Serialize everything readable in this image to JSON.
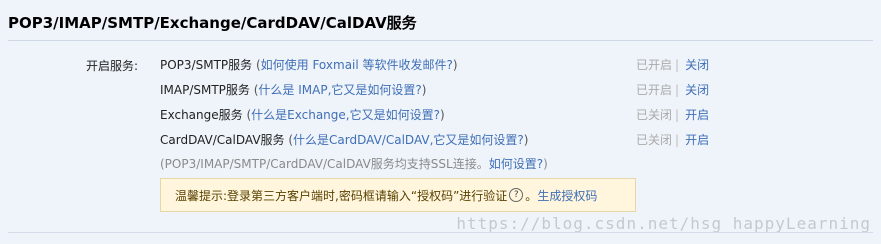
{
  "header": {
    "title": "POP3/IMAP/SMTP/Exchange/CardDAV/CalDAV服务"
  },
  "services_label": "开启服务:",
  "services": [
    {
      "name": "POP3/SMTP服务",
      "paren_open": " (",
      "help": "如何使用 Foxmail 等软件收发邮件?",
      "paren_close": ")",
      "status": "已开启",
      "action": "关闭"
    },
    {
      "name": "IMAP/SMTP服务",
      "paren_open": " (",
      "help": "什么是 IMAP,它又是如何设置?",
      "paren_close": ")",
      "status": "已开启",
      "action": "关闭"
    },
    {
      "name": "Exchange服务",
      "paren_open": " (",
      "help": "什么是Exchange,它又是如何设置?",
      "paren_close": ")",
      "status": "已关闭",
      "action": "开启"
    },
    {
      "name": "CardDAV/CalDAV服务",
      "paren_open": " (",
      "help": "什么是CardDAV/CalDAV,它又是如何设置?",
      "paren_close": ")",
      "status": "已关闭",
      "action": "开启"
    }
  ],
  "status_separator": "|",
  "ssl_note": {
    "text": "(POP3/IMAP/SMTP/CardDAV/CalDAV服务均支持SSL连接。",
    "help": "如何设置?",
    "close": ")"
  },
  "tip": {
    "text": "温馨提示:登录第三方客户端时,密码框请输入“授权码”进行验证",
    "question_icon": "?",
    "period": "。",
    "link": "生成授权码"
  },
  "watermark": "https://blog.csdn.net/hsg_happyLearning"
}
